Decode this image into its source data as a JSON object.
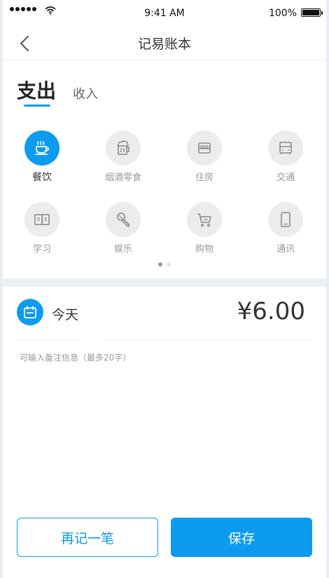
{
  "status_bar": {
    "time": "9:41 AM",
    "battery": "100%"
  },
  "nav": {
    "title": "记易账本"
  },
  "type_tabs": {
    "active": "支出",
    "inactive": "收入"
  },
  "categories": [
    {
      "label": "餐饮",
      "icon": "coffee-cup-icon",
      "active": true
    },
    {
      "label": "烟酒零食",
      "icon": "beer-mug-icon",
      "active": false
    },
    {
      "label": "住房",
      "icon": "bed-icon",
      "active": false
    },
    {
      "label": "交通",
      "icon": "bus-icon",
      "active": false
    },
    {
      "label": "学习",
      "icon": "book-icon",
      "active": false
    },
    {
      "label": "娱乐",
      "icon": "microphone-icon",
      "active": false
    },
    {
      "label": "购物",
      "icon": "shopping-cart-icon",
      "active": false
    },
    {
      "label": "通讯",
      "icon": "phone-icon",
      "active": false
    }
  ],
  "entry": {
    "date_label": "今天",
    "amount": "¥6.00",
    "note_placeholder": "可输入备注信息（最多20字）"
  },
  "buttons": {
    "again": "再记一笔",
    "save": "保存"
  },
  "colors": {
    "accent": "#0d9bf0",
    "icon_bg": "#ececec",
    "icon_stroke": "#8a8a8a"
  }
}
